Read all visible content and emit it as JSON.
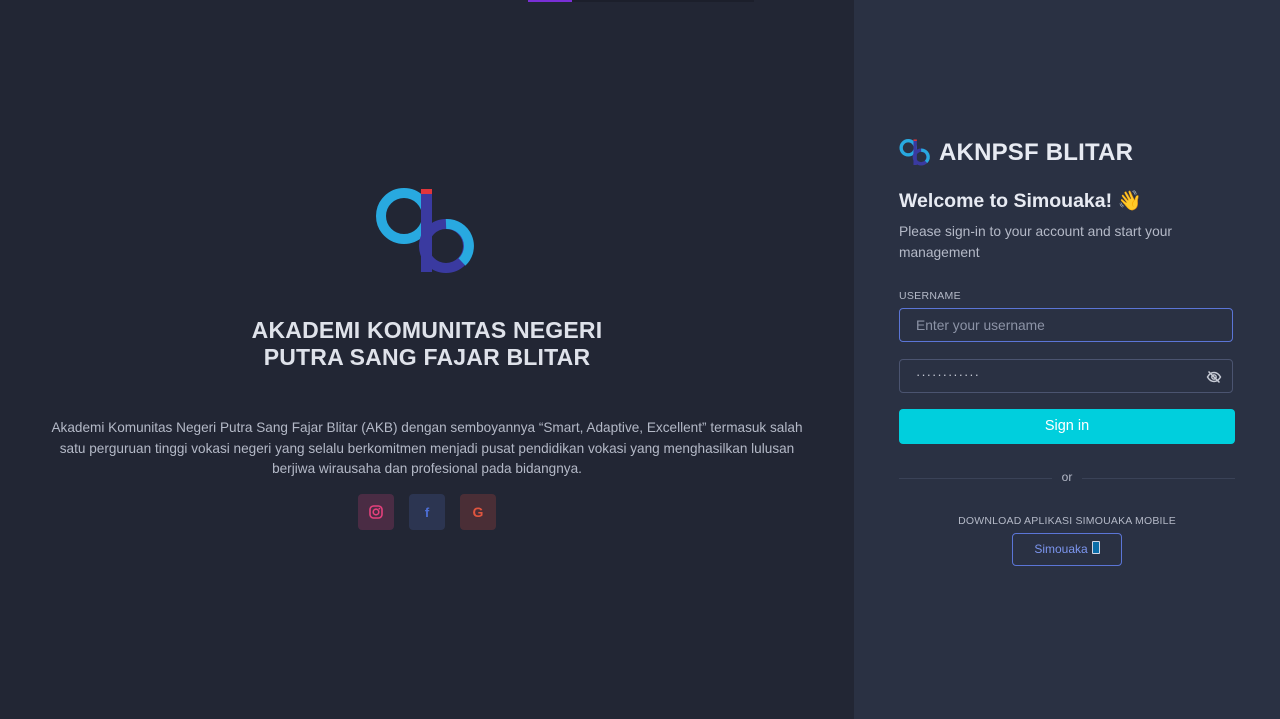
{
  "institution": {
    "title_line1": "AKADEMI KOMUNITAS NEGERI",
    "title_line2": "PUTRA SANG FAJAR BLITAR",
    "description": "Akademi Komunitas Negeri Putra Sang Fajar Blitar (AKB) dengan semboyannya “Smart, Adaptive, Excellent” termasuk salah satu perguruan tinggi vokasi negeri yang selalu berkomitmen menjadi pusat pendidikan vokasi yang menghasilkan lulusan berjiwa wirausaha dan profesional pada bidangnya.",
    "socials": [
      {
        "icon": "instagram-icon",
        "glyph": "◎",
        "color": "#e4407c"
      },
      {
        "icon": "facebook-icon",
        "glyph": "f",
        "color": "#4d6fd8"
      },
      {
        "icon": "google-icon",
        "glyph": "G",
        "color": "#e0553f"
      }
    ]
  },
  "login": {
    "brand": "AKNPSF BLITAR",
    "welcome": "Welcome to Simouaka! 👋",
    "subtitle": "Please sign-in to your account and start your management",
    "username_label": "USERNAME",
    "username_placeholder": "Enter your username",
    "password_value": "············",
    "signin_label": "Sign in",
    "or_label": "or",
    "download_label": "DOWNLOAD APLIKASI SIMOUAKA MOBILE",
    "app_button_label": "Simouaka"
  },
  "colors": {
    "accent": "#00cfdd",
    "primary": "#5b75d6",
    "background_left": "#222634",
    "background_right": "#2a3143"
  }
}
